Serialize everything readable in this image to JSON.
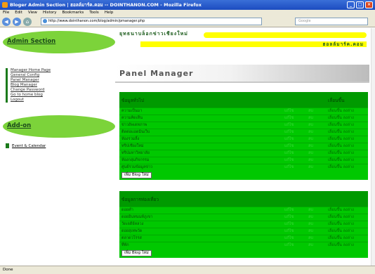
{
  "window": {
    "title": "Bloger Admin Section | ฮอลล์มาร์ค.คอม -- DOINTHANON.COM - Mozilla Firefox"
  },
  "menubar": [
    "File",
    "Edit",
    "View",
    "History",
    "Bookmarks",
    "Tools",
    "Help"
  ],
  "navbar": {
    "url": "http://www.dointhanon.com/blog/admin/pmanager.php",
    "search_placeholder": "Google"
  },
  "sidebar": {
    "admin_title": "Admin Section",
    "items": [
      "Manager Home Page",
      "General Config",
      "Panel Manager",
      "Blog Manager",
      "Change Password",
      "Go to home blog",
      "Logout"
    ],
    "addon_title": "Add-on",
    "addon_items": [
      "Event & Calendar"
    ]
  },
  "header": {
    "title": "ยุทธนาบล็อกข่าวเชียงใหม่",
    "subtitle": "ฮอลล์มาร์ค.คอม"
  },
  "panel_title": "Panel Manager",
  "table1": {
    "header": "ข้อมูลทั่วไป",
    "col_c": "เลื่อนขึ้น",
    "rows": [
      {
        "label": "ความเป็นมา",
        "a": "แก้ไข",
        "b": "ลบ",
        "c": "เลื่อนขึ้น ลงล่าง"
      },
      {
        "label": "ความคิดเห็น",
        "a": "แก้ไข",
        "b": "ลบ",
        "c": "เลื่อนขึ้น ลงล่าง"
      },
      {
        "label": "ข่าวอัพเดทภาพ",
        "a": "แก้ไข",
        "b": "ลบ",
        "c": "เลื่อนขึ้น ลงล่าง"
      },
      {
        "label": "ติดต่อแอดมินเว็บ",
        "a": "แก้ไข",
        "b": "ลบ",
        "c": "เลื่อนขึ้น ลงล่าง"
      },
      {
        "label": "ห้องรวมลิ้ง",
        "a": "แก้ไข",
        "b": "ลบ",
        "c": "เลื่อนขึ้น ลงล่าง"
      },
      {
        "label": "ทริปเชียงใหม่",
        "a": "แก้ไข",
        "b": "ลบ",
        "c": "เลื่อนขึ้น ลงล่าง"
      },
      {
        "label": "ทริปมหาวิทยาลัย",
        "a": "แก้ไข",
        "b": "ลบ",
        "c": "เลื่อนขึ้น ลงล่าง"
      },
      {
        "label": "ห้องกลุ่มกิจกรรม",
        "a": "แก้ไข",
        "b": "ลบ",
        "c": "เลื่อนขึ้น ลงล่าง"
      },
      {
        "label": "ศูนย์รวมข้อมูลข่าว",
        "a": "แก้ไข",
        "b": "ลบ",
        "c": "เลื่อนขึ้น ลงล่าง"
      }
    ],
    "button": "เพิ่ม Blog ใหม่"
  },
  "table2": {
    "header": "ข้อมูลการท่องเที่ยว",
    "rows": [
      {
        "label": "ดอยคำ",
        "a": "แก้ไข",
        "b": "ลบ",
        "c": "เลื่อนขึ้น ลงล่าง"
      },
      {
        "label": "ดอยอินทนนท์ภูเขา",
        "a": "แก้ไข",
        "b": "ลบ",
        "c": "เลื่อนขึ้น ลงล่าง"
      },
      {
        "label": "วัดเจดีย์หลวง",
        "a": "แก้ไข",
        "b": "ลบ",
        "c": "เลื่อนขึ้น ลงล่าง"
      },
      {
        "label": "ดอยสุเทพวัด",
        "a": "แก้ไข",
        "b": "ลบ",
        "c": "เลื่อนขึ้น ลงล่าง"
      },
      {
        "label": "ตลาดวโรรส",
        "a": "แก้ไข",
        "b": "ลบ",
        "c": "เลื่อนขึ้น ลงล่าง"
      },
      {
        "label": "ที่พัก",
        "a": "แก้ไข",
        "b": "ลบ",
        "c": "เลื่อนขึ้น ลงล่าง"
      }
    ],
    "button": "เพิ่ม Blog ใหม่"
  },
  "status": "Done"
}
